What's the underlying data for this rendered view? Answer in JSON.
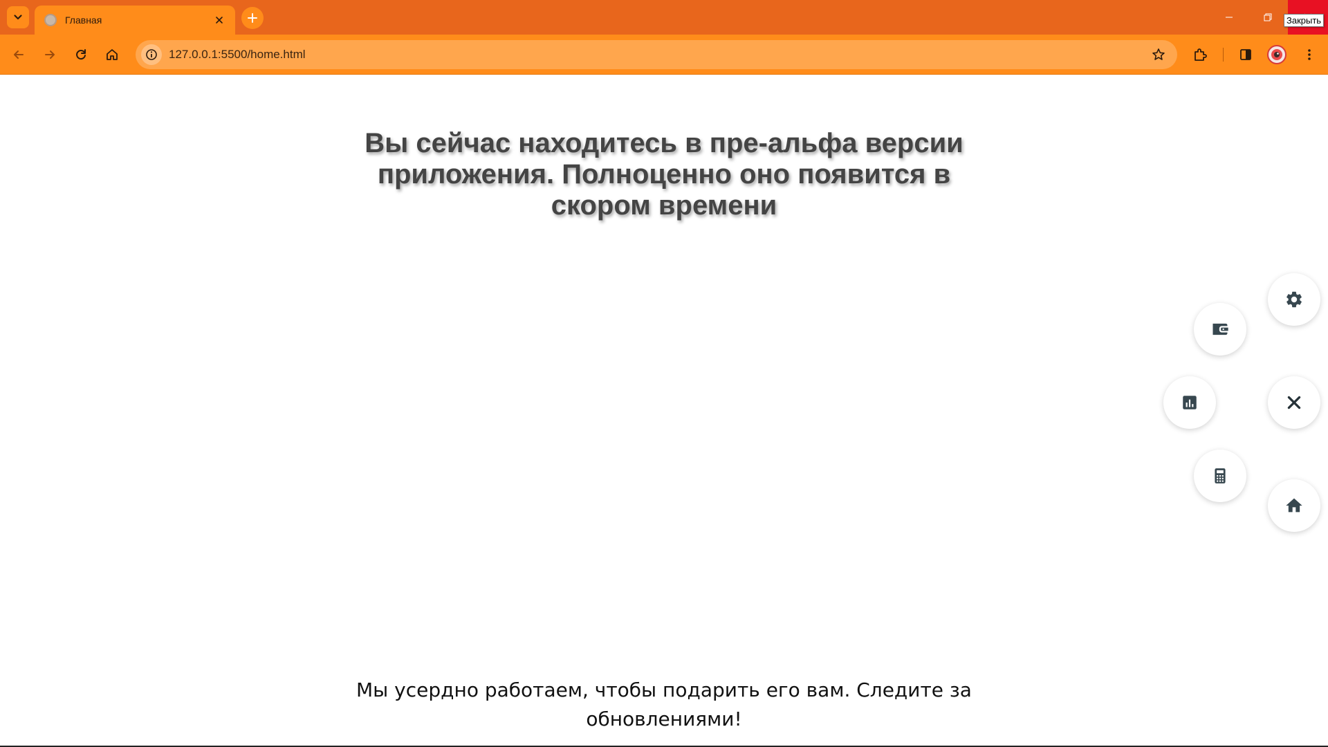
{
  "browser": {
    "tab_title": "Главная",
    "url": "127.0.0.1:5500/home.html",
    "tooltip": "Закрыть"
  },
  "page": {
    "headline": "Вы сейчас находитесь в пре-альфа версии приложения. Полноценно оно появится в скором времени",
    "subline": "Мы усердно работаем, чтобы подарить его вам. Следите за обновлениями!"
  },
  "fab_menu": {
    "items": [
      {
        "name": "settings",
        "icon": "gear-icon"
      },
      {
        "name": "wallet",
        "icon": "wallet-icon"
      },
      {
        "name": "statistics",
        "icon": "bar-chart-icon"
      },
      {
        "name": "close",
        "icon": "close-icon"
      },
      {
        "name": "calculator",
        "icon": "calculator-icon"
      },
      {
        "name": "home",
        "icon": "home-icon"
      }
    ],
    "icon_color": "#37474f"
  },
  "colors": {
    "tabstrip": "#e8661c",
    "toolbar": "#ff8c1a",
    "omnibox": "#ffa64d",
    "close_button": "#e81123",
    "headline_text": "#444444"
  }
}
